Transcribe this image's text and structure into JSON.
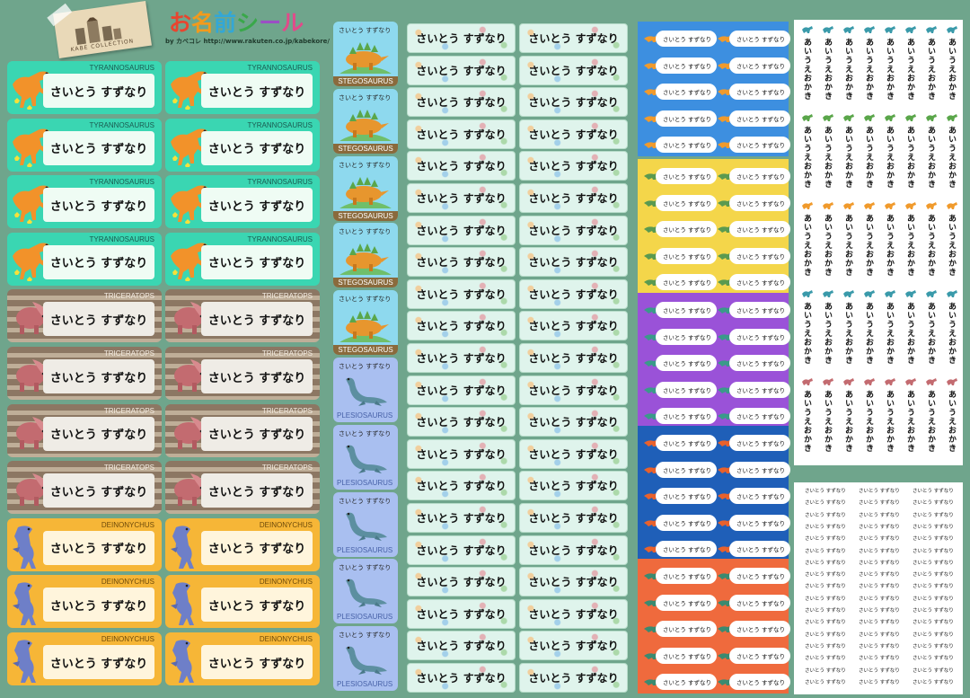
{
  "header": {
    "brand": "KABE COLLECTION",
    "title_chars": [
      "お",
      "名",
      "前",
      "シ",
      "ー",
      "ル"
    ],
    "byline": "by カベコレ   http://www.rakuten.co.jp/kabekore/"
  },
  "name_label": "さいとう すずなり",
  "vertical_name": "さいとう すずなり",
  "small_name": "さいとう すずなり",
  "vertical_kana": "あいうえおかき",
  "tiny_name": "さいとう すずなり",
  "species": {
    "tyrannosaurus": "TYRANNOSAURUS",
    "triceratops": "TRICERATOPS",
    "deinonychus": "DEINONYCHUS",
    "stegosaurus": "STEGOSAURUS",
    "plesiosaurus": "PLESIOSAURUS"
  },
  "colors": {
    "background": "#6fa58c",
    "tyrannosaurus_sheet": "#3ad6b2",
    "triceratops_sheet": "#8c7763",
    "deinonychus_sheet": "#f6b637",
    "stegosaurus_sheet": "#8ed9ee",
    "plesiosaurus_sheet": "#a9bff0",
    "band_blue_light": "#3d8fe0",
    "band_yellow": "#f4d64a",
    "band_purple": "#9a52d8",
    "band_blue_dark": "#1f5fb8",
    "band_orange": "#ef6a3d"
  }
}
